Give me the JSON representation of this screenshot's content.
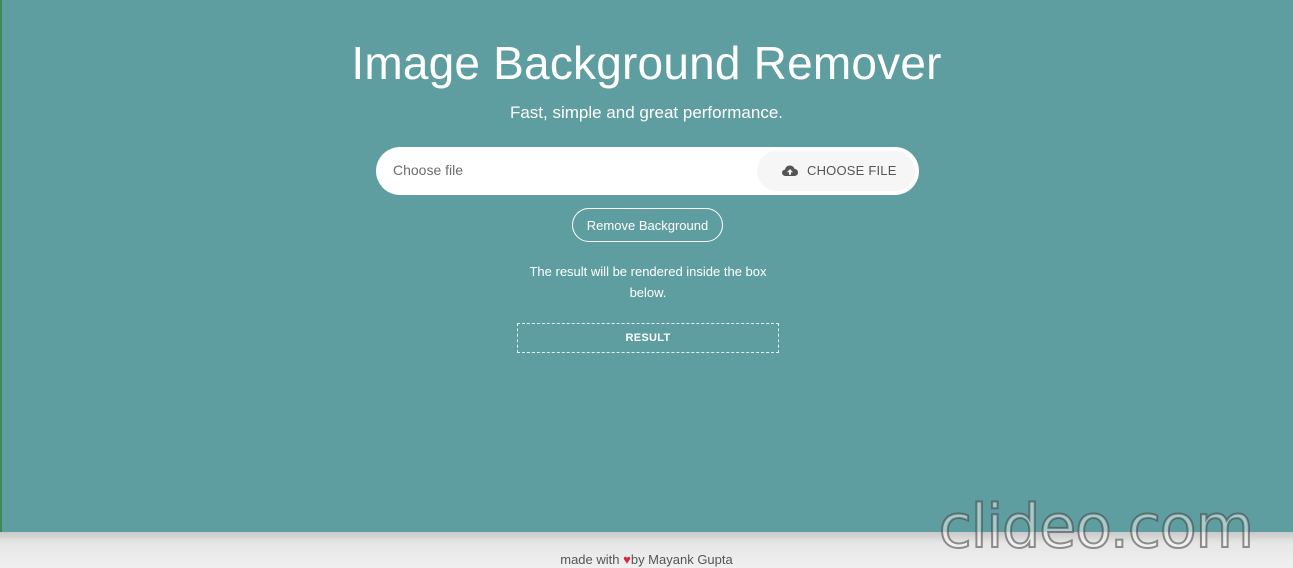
{
  "app": {
    "title": "Image Background Remover",
    "subtitle": "Fast, simple and great performance."
  },
  "file_input": {
    "placeholder": "Choose file",
    "button_label": "CHOOSE FILE",
    "button_icon": "cloud-upload-icon"
  },
  "actions": {
    "remove_label": "Remove Background"
  },
  "info": {
    "text": "The result will be rendered inside the box below."
  },
  "result": {
    "label": "RESULT"
  },
  "footer": {
    "prefix": "made with ",
    "heart": "♥",
    "suffix": "by Mayank Gupta",
    "heart_color": "#d8283c"
  },
  "watermark": {
    "text": "clideo.com"
  },
  "colors": {
    "background": "#5f9ea0",
    "text": "#ffffff"
  }
}
